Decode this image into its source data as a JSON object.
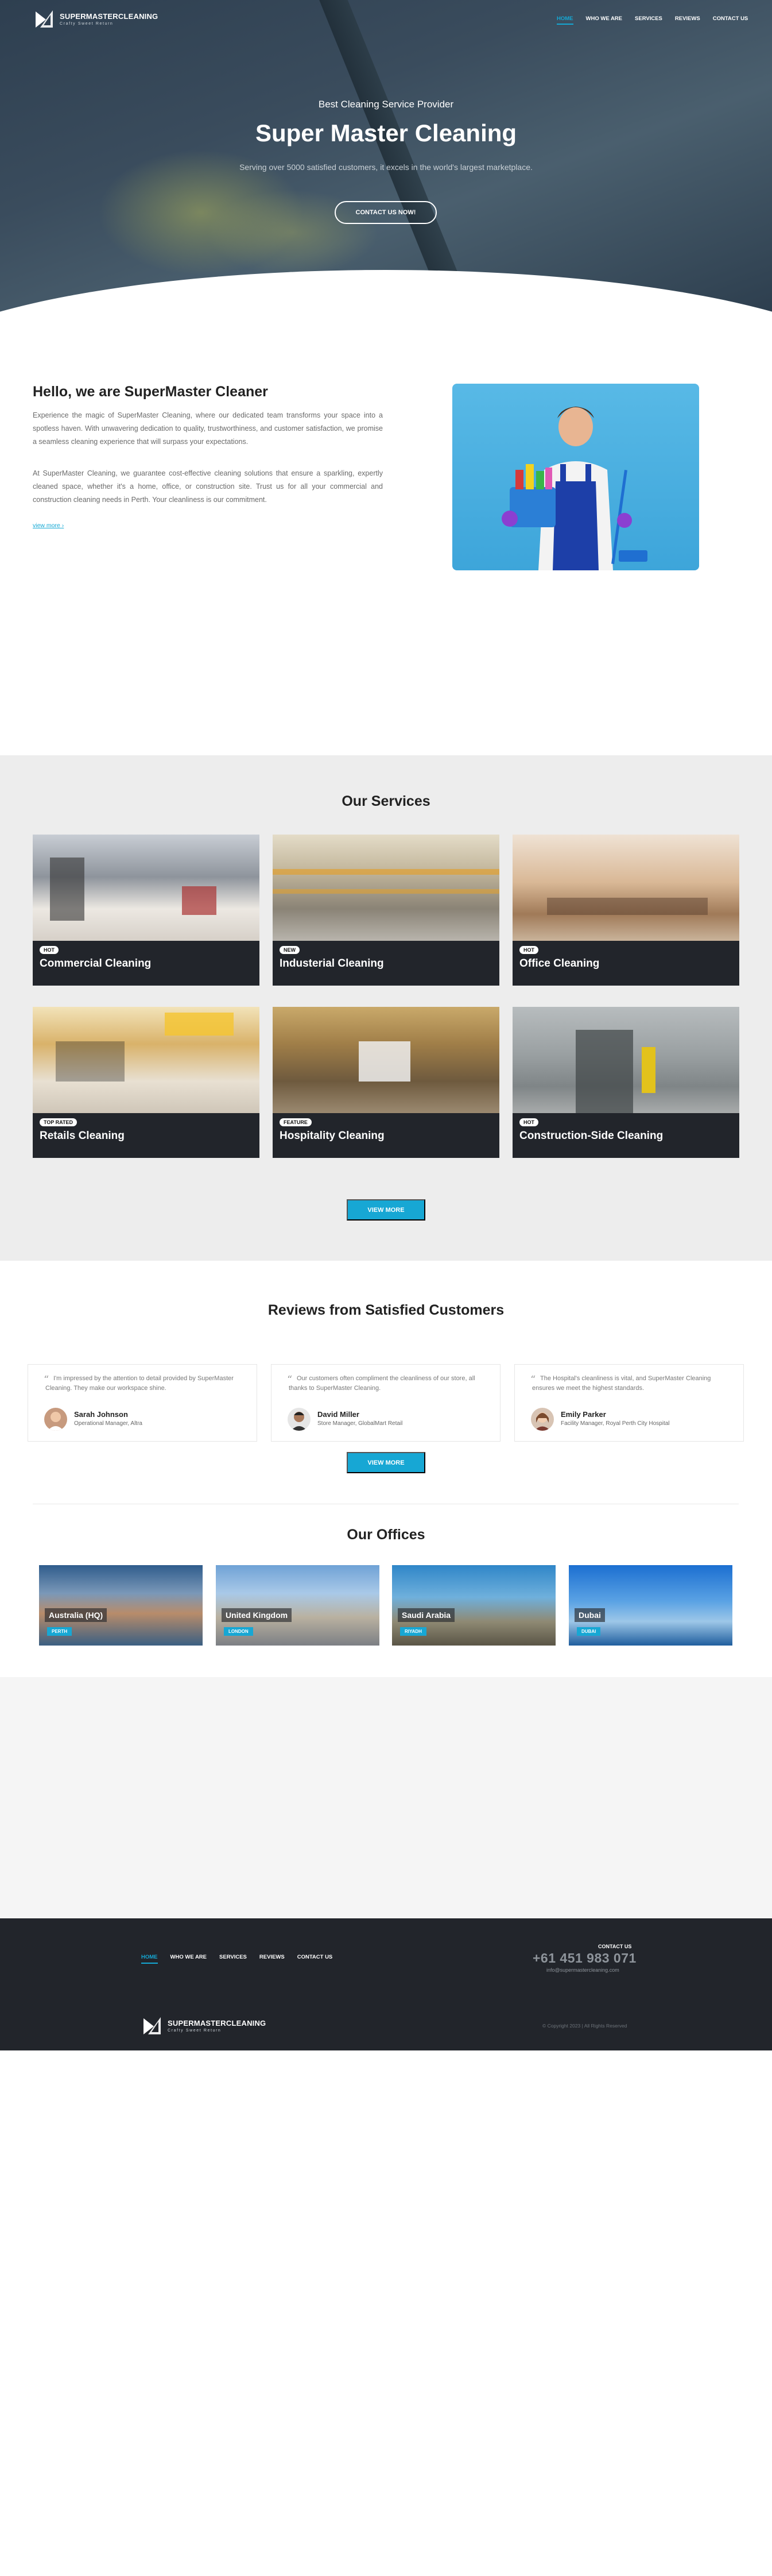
{
  "brand": {
    "name": "SUPERMASTERCLEANING",
    "tagline": "Crafty Sweet Return"
  },
  "nav": {
    "items": [
      "HOME",
      "WHO WE ARE",
      "SERVICES",
      "REVIEWS",
      "CONTACT US"
    ],
    "active": "HOME"
  },
  "hero": {
    "subtitle": "Best Cleaning Service Provider",
    "title": "Super Master Cleaning",
    "description": "Serving over 5000 satisfied customers, it excels in the world's largest marketplace.",
    "button": "CONTACT US NOW!"
  },
  "about": {
    "title": "Hello, we are SuperMaster Cleaner",
    "p1": "Experience the magic of SuperMaster Cleaning, where our dedicated team transforms your space into a spotless haven. With unwavering dedication to quality, trustworthiness, and customer satisfaction, we promise a seamless cleaning experience that will surpass your expectations.",
    "p2": "At SuperMaster Cleaning, we guarantee cost-effective cleaning solutions that ensure a sparkling, expertly cleaned space, whether it's a home, office, or construction site. Trust us for all your commercial and construction cleaning needs in Perth. Your cleanliness is our commitment.",
    "more": "view more"
  },
  "services": {
    "title_pre": "Our ",
    "title_bold": "Services",
    "cards": [
      {
        "badge": "HOT",
        "title": "Commercial Cleaning"
      },
      {
        "badge": "NEW",
        "title": "Industerial Cleaning"
      },
      {
        "badge": "HOT",
        "title": "Office Cleaning"
      },
      {
        "badge": "TOP RATED",
        "title": "Retails Cleaning"
      },
      {
        "badge": "FEATURE",
        "title": "Hospitality Cleaning"
      },
      {
        "badge": "HOT",
        "title": "Construction-Side Cleaning"
      }
    ],
    "button": "VIEW MORE"
  },
  "reviews": {
    "title_pre": "Reviews from ",
    "title_bold": "Satisfied Customers",
    "items": [
      {
        "text": "I'm impressed by the attention to detail provided by SuperMaster Cleaning. They make our workspace shine.",
        "name": "Sarah Johnson",
        "role": "Operational Manager, Altra"
      },
      {
        "text": "Our customers often compliment the cleanliness of our store, all thanks to SuperMaster Cleaning.",
        "name": "David Miller",
        "role": "Store Manager, GlobalMart Retail"
      },
      {
        "text": "The Hospital's cleanliness is vital, and SuperMaster Cleaning ensures we meet the highest standards.",
        "name": "Emily Parker",
        "role": "Facility Manager, Royal Perth City Hospital"
      }
    ],
    "button": "VIEW MORE"
  },
  "offices": {
    "title_pre": "Our ",
    "title_bold": "Offices",
    "items": [
      {
        "city": "Australia (HQ)",
        "tag": "PERTH"
      },
      {
        "city": "United Kingdom",
        "tag": "LONDON"
      },
      {
        "city": "Saudi Arabia",
        "tag": "RIYADH"
      },
      {
        "city": "Dubai",
        "tag": "DUBAI"
      }
    ]
  },
  "footer": {
    "contact_label": "CONTACT US",
    "phone": "+61 451 983 071",
    "email": "info@supermastercleaning.com",
    "copyright": "© Copyright 2023 | All Rights Reserved"
  }
}
